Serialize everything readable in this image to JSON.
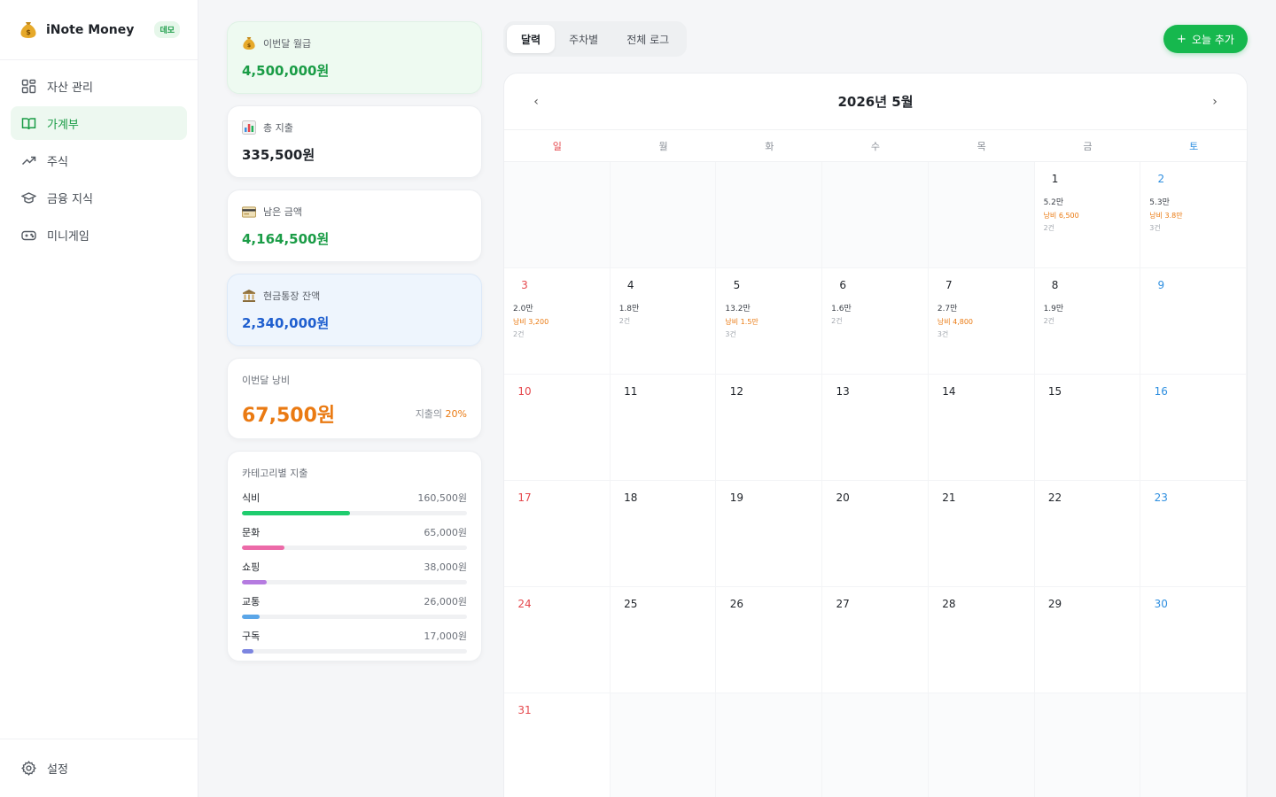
{
  "sidebar": {
    "brand": "iNote Money",
    "badge": "데모",
    "items": [
      {
        "label": "자산 관리",
        "icon": "grid-icon",
        "active": false
      },
      {
        "label": "가계부",
        "icon": "book-icon",
        "active": true
      },
      {
        "label": "주식",
        "icon": "trend-icon",
        "active": false
      },
      {
        "label": "금융 지식",
        "icon": "graduation-cap-icon",
        "active": false
      },
      {
        "label": "미니게임",
        "icon": "gamepad-icon",
        "active": false
      }
    ],
    "settings": "설정"
  },
  "stats": {
    "salary": {
      "label": "이번달 월급",
      "value": "4,500,000원"
    },
    "expense": {
      "label": "총 지출",
      "value": "335,500원"
    },
    "remaining": {
      "label": "남은 금액",
      "value": "4,164,500원"
    },
    "cash": {
      "label": "현금통장 잔액",
      "value": "2,340,000원"
    },
    "waste": {
      "label": "이번달 낭비",
      "value": "67,500원",
      "ratio_prefix": "지출의 ",
      "ratio": "20%"
    }
  },
  "categories": {
    "title": "카테고리별 지출",
    "items": [
      {
        "name": "식비",
        "amount": "160,500원",
        "ratio": 0.48,
        "color": "#1fcc6e"
      },
      {
        "name": "문화",
        "amount": "65,000원",
        "ratio": 0.19,
        "color": "#ec6aa8"
      },
      {
        "name": "쇼핑",
        "amount": "38,000원",
        "ratio": 0.11,
        "color": "#b57be0"
      },
      {
        "name": "교통",
        "amount": "26,000원",
        "ratio": 0.08,
        "color": "#5ba6e8"
      },
      {
        "name": "구독",
        "amount": "17,000원",
        "ratio": 0.05,
        "color": "#7c85e0"
      }
    ]
  },
  "tabs": [
    {
      "label": "달력",
      "active": true
    },
    {
      "label": "주차별",
      "active": false
    },
    {
      "label": "전체 로그",
      "active": false
    }
  ],
  "add_button": {
    "label": "오늘 추가"
  },
  "calendar": {
    "title": "2026년 5월",
    "prev": "‹",
    "next": "›",
    "weekdays": [
      "일",
      "월",
      "화",
      "수",
      "목",
      "금",
      "토"
    ],
    "leading_blanks": 5,
    "trailing_blanks": 6,
    "days": [
      {
        "day": "1",
        "total": "5.2만",
        "waste": "낭비 6,500",
        "count": "2건"
      },
      {
        "day": "2",
        "total": "5.3만",
        "waste": "낭비 3.8만",
        "count": "3건"
      },
      {
        "day": "3",
        "total": "2.0만",
        "waste": "낭비 3,200",
        "count": "2건"
      },
      {
        "day": "4",
        "total": "1.8만",
        "waste": "",
        "count": "2건"
      },
      {
        "day": "5",
        "total": "13.2만",
        "waste": "낭비 1.5만",
        "count": "3건"
      },
      {
        "day": "6",
        "total": "1.6만",
        "waste": "",
        "count": "2건"
      },
      {
        "day": "7",
        "total": "2.7만",
        "waste": "낭비 4,800",
        "count": "3건"
      },
      {
        "day": "8",
        "total": "1.9만",
        "waste": "",
        "count": "2건"
      },
      {
        "day": "9"
      },
      {
        "day": "10"
      },
      {
        "day": "11"
      },
      {
        "day": "12"
      },
      {
        "day": "13"
      },
      {
        "day": "14"
      },
      {
        "day": "15"
      },
      {
        "day": "16"
      },
      {
        "day": "17"
      },
      {
        "day": "18"
      },
      {
        "day": "19"
      },
      {
        "day": "20"
      },
      {
        "day": "21"
      },
      {
        "day": "22"
      },
      {
        "day": "23"
      },
      {
        "day": "24"
      },
      {
        "day": "25"
      },
      {
        "day": "26"
      },
      {
        "day": "27"
      },
      {
        "day": "28"
      },
      {
        "day": "29"
      },
      {
        "day": "30"
      },
      {
        "day": "31"
      }
    ]
  },
  "colors": {
    "accent": "#16b84e",
    "sunday": "#e5484d",
    "saturday": "#2f8fe0",
    "waste": "#ea7a12"
  }
}
